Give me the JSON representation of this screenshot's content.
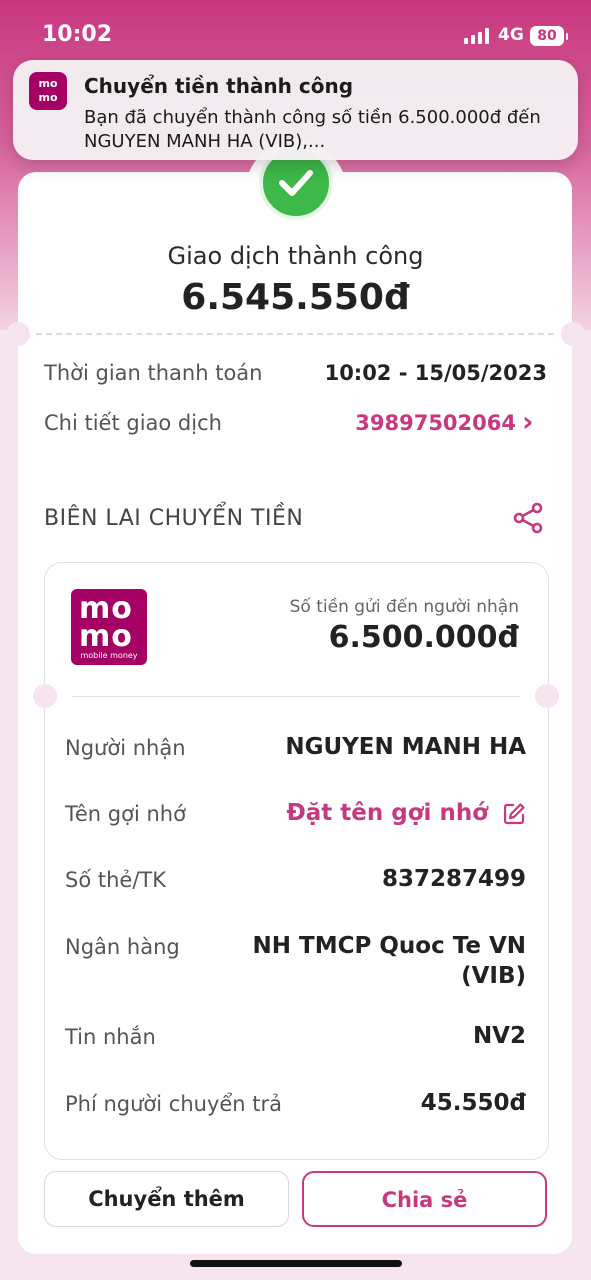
{
  "status_bar": {
    "time": "10:02",
    "network": "4G",
    "battery": "80"
  },
  "notification": {
    "app_logo_text": "momo",
    "title": "Chuyển tiền thành công",
    "body": "Bạn đã chuyển thành công số tiền 6.500.000đ đến NGUYEN MANH HA (VIB),..."
  },
  "summary": {
    "status": "Giao dịch thành công",
    "total": "6.545.550đ",
    "payment_time_label": "Thời gian thanh toán",
    "payment_time_value": "10:02 - 15/05/2023",
    "transaction_detail_label": "Chi tiết giao dịch",
    "transaction_id": "39897502064",
    "chevron": "›"
  },
  "receipt": {
    "section_title": "BIÊN LAI CHUYỂN TIỀN",
    "logo_line1": "mo",
    "logo_line2": "mo",
    "logo_tagline": "mobile money",
    "sent_label": "Số tiền gửi đến người nhận",
    "sent_amount": "6.500.000đ",
    "rows": [
      {
        "label": "Người nhận",
        "value": "NGUYEN MANH HA"
      },
      {
        "label": "Tên gợi nhớ",
        "value": "Đặt tên gợi nhớ"
      },
      {
        "label": "Số thẻ/TK",
        "value": "837287499"
      },
      {
        "label": "Ngân hàng",
        "value": "NH TMCP Quoc Te VN",
        "value2": "(VIB)"
      },
      {
        "label": "Tin nhắn",
        "value": "NV2"
      },
      {
        "label": "Phí người chuyển trả",
        "value": "45.550đ"
      }
    ]
  },
  "actions": {
    "transfer_more": "Chuyển thêm",
    "share": "Chia sẻ"
  },
  "colors": {
    "brand": "#a50064",
    "accent": "#c7387f",
    "success": "#3fb84a"
  },
  "icons": [
    "signal-icon",
    "battery-icon",
    "momo-logo",
    "success-check-icon",
    "chevron-right-icon",
    "share-icon",
    "edit-icon"
  ]
}
